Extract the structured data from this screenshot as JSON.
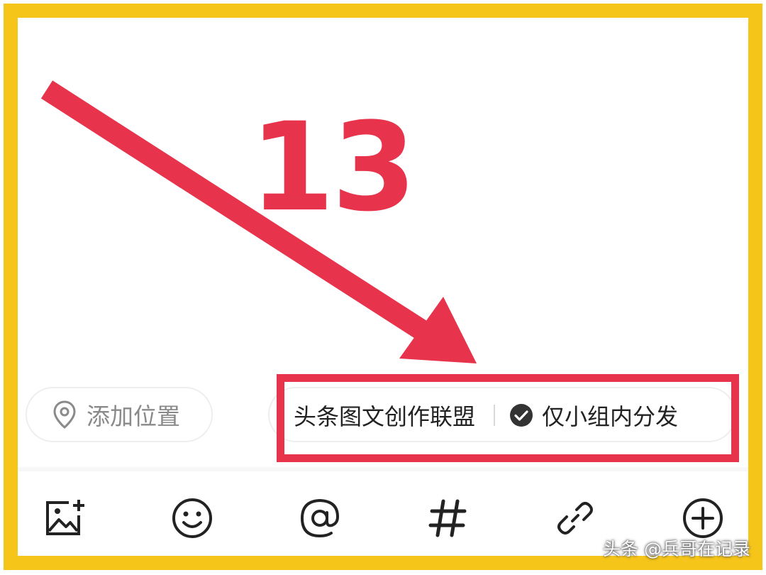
{
  "annotation": {
    "step_number": "13",
    "accent_color": "#E7334B",
    "frame_color": "#F6C51A"
  },
  "location": {
    "icon": "location-pin-icon",
    "label": "添加位置"
  },
  "group": {
    "name": "头条图文创作联盟",
    "check_icon": "check-circle-icon",
    "option_label": "仅小组内分发",
    "option_checked": true
  },
  "toolbar": {
    "items": [
      {
        "icon": "add-image-icon"
      },
      {
        "icon": "emoji-icon"
      },
      {
        "icon": "mention-icon"
      },
      {
        "icon": "hashtag-icon"
      },
      {
        "icon": "link-icon"
      },
      {
        "icon": "add-more-icon"
      }
    ]
  },
  "watermark": "头条 @兵哥在记录"
}
